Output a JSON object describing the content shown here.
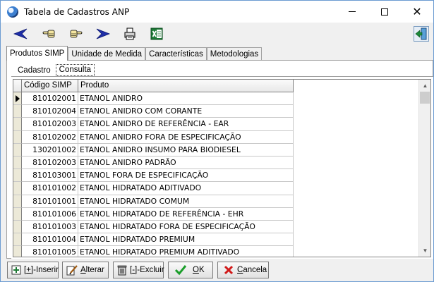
{
  "window": {
    "title": "Tabela de Cadastros ANP",
    "controls": {
      "minimize": "—",
      "maximize": "☐",
      "close": "✕"
    }
  },
  "toolbar": {
    "icons": [
      "arrow-left-icon",
      "hand-left-icon",
      "hand-right-icon",
      "arrow-right-icon",
      "printer-icon",
      "excel-icon",
      "exit-door-icon"
    ]
  },
  "tabs": [
    {
      "label": "Produtos SIMP",
      "active": true
    },
    {
      "label": "Unidade de Medida",
      "active": false
    },
    {
      "label": "Características",
      "active": false
    },
    {
      "label": "Metodologias",
      "active": false
    }
  ],
  "subtabs": [
    {
      "label": "Cadastro",
      "active": false
    },
    {
      "label": "Consulta",
      "active": true
    }
  ],
  "grid": {
    "columns": [
      "Código SIMP",
      "Produto"
    ],
    "rows": [
      {
        "code": "810102001",
        "product": "ETANOL ANIDRO",
        "current": true
      },
      {
        "code": "810102004",
        "product": "ETANOL ANIDRO COM CORANTE"
      },
      {
        "code": "810102003",
        "product": "ETANOL ANIDRO DE REFERÊNCIA - EAR"
      },
      {
        "code": "810102002",
        "product": "ETANOL ANIDRO FORA DE ESPECIFICAÇÃO"
      },
      {
        "code": "130201002",
        "product": "ETANOL ANIDRO INSUMO PARA BIODIESEL"
      },
      {
        "code": "810102003",
        "product": "ETANOL ANIDRO PADRÃO"
      },
      {
        "code": "810103001",
        "product": "ETANOL FORA DE ESPECIFICAÇÃO"
      },
      {
        "code": "810101002",
        "product": "ETANOL HIDRATADO ADITIVADO"
      },
      {
        "code": "810101001",
        "product": "ETANOL HIDRATADO COMUM"
      },
      {
        "code": "810101006",
        "product": "ETANOL HIDRATADO DE REFERÊNCIA - EHR"
      },
      {
        "code": "810101003",
        "product": "ETANOL HIDRATADO FORA DE ESPECIFICAÇÃO"
      },
      {
        "code": "810101004",
        "product": "ETANOL HIDRATADO PREMIUM"
      },
      {
        "code": "810101005",
        "product": "ETANOL HIDRATADO PREMIUM ADITIVADO"
      }
    ]
  },
  "buttons": {
    "insert": {
      "prefix": "[",
      "hot": "+",
      "suffix": "]-Inserir"
    },
    "edit": {
      "hot": "A",
      "rest": "lterar"
    },
    "delete": {
      "prefix": "[",
      "hot": "-",
      "suffix": "]-Excluir"
    },
    "ok": {
      "hot": "O",
      "rest": "K"
    },
    "cancel": {
      "hot": "C",
      "rest": "ancela"
    }
  },
  "colors": {
    "nav_arrow": "#1f2fa8",
    "excel_green": "#1d7a35",
    "ok_green": "#1b9e2a",
    "cancel_red": "#d11a1a"
  }
}
